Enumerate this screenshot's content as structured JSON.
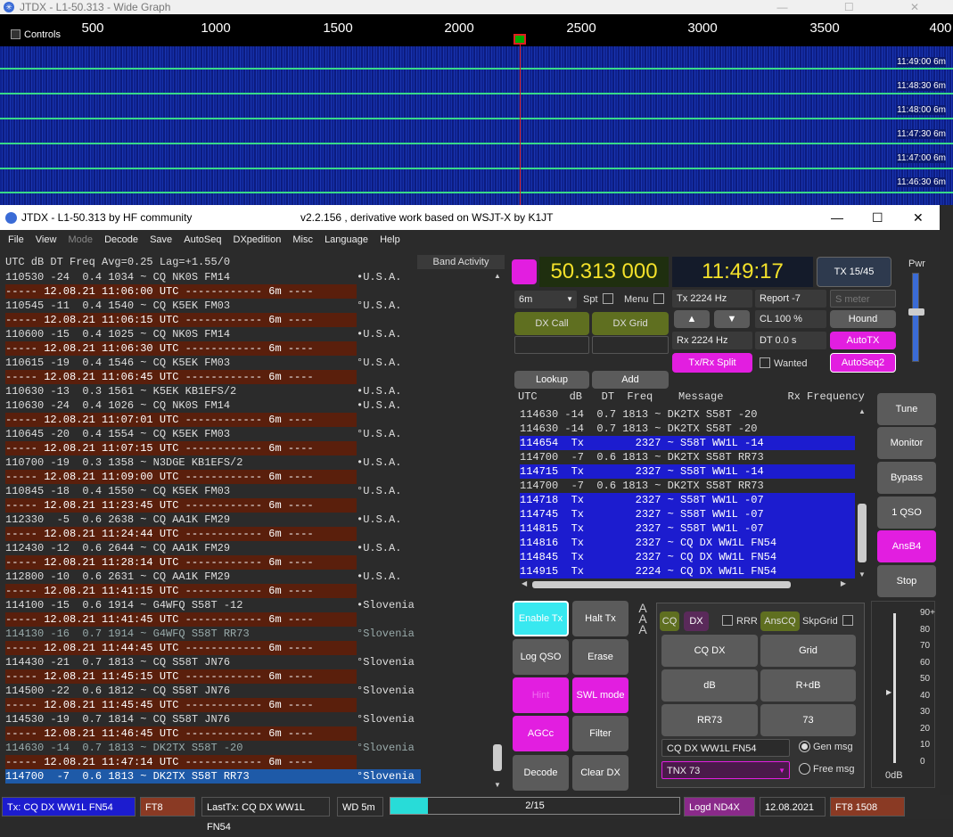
{
  "wide_graph": {
    "title": "JTDX - L1-50.313 - Wide Graph",
    "controls_label": "Controls",
    "ticks": [
      "500",
      "1000",
      "1500",
      "2000",
      "2500",
      "3000",
      "3500",
      "400"
    ],
    "times": [
      "11:49:00   6m",
      "11:48:30   6m",
      "11:48:00   6m",
      "11:47:30   6m",
      "11:47:00   6m",
      "11:46:30   6m"
    ]
  },
  "main": {
    "title": "JTDX - L1-50.313  by HF community",
    "version": "v2.2.156 , derivative work based on WSJT-X by K1JT",
    "win_min": "—",
    "win_max": "☐",
    "win_close": "✕"
  },
  "menu": [
    "File",
    "View",
    "Mode",
    "Decode",
    "Save",
    "AutoSeq",
    "DXpedition",
    "Misc",
    "Language",
    "Help"
  ],
  "band_activity": {
    "header": "UTC      dB  DT Freq    Avg=0.25 Lag=+1.55/0",
    "button": "Band Activity",
    "rows": [
      {
        "t": "110530 -24  0.4 1034 ~ CQ NK0S FM14",
        "c": "•U.S.A.",
        "k": "n"
      },
      {
        "t": "----- 12.08.21 11:06:00 UTC ------------ 6m ----",
        "c": "",
        "k": "sep"
      },
      {
        "t": "110545 -11  0.4 1540 ~ CQ K5EK FM03",
        "c": "°U.S.A.",
        "k": "n"
      },
      {
        "t": "----- 12.08.21 11:06:15 UTC ------------ 6m ----",
        "c": "",
        "k": "sep"
      },
      {
        "t": "110600 -15  0.4 1025 ~ CQ NK0S FM14",
        "c": "•U.S.A.",
        "k": "n"
      },
      {
        "t": "----- 12.08.21 11:06:30 UTC ------------ 6m ----",
        "c": "",
        "k": "sep"
      },
      {
        "t": "110615 -19  0.4 1546 ~ CQ K5EK FM03",
        "c": "°U.S.A.",
        "k": "n"
      },
      {
        "t": "----- 12.08.21 11:06:45 UTC ------------ 6m ----",
        "c": "",
        "k": "sep"
      },
      {
        "t": "110630 -13  0.3 1561 ~ K5EK KB1EFS/2",
        "c": "•U.S.A.",
        "k": "n"
      },
      {
        "t": "110630 -24  0.4 1026 ~ CQ NK0S FM14",
        "c": "•U.S.A.",
        "k": "n"
      },
      {
        "t": "----- 12.08.21 11:07:01 UTC ------------ 6m ----",
        "c": "",
        "k": "sep"
      },
      {
        "t": "110645 -20  0.4 1554 ~ CQ K5EK FM03",
        "c": "°U.S.A.",
        "k": "n"
      },
      {
        "t": "----- 12.08.21 11:07:15 UTC ------------ 6m ----",
        "c": "",
        "k": "sep"
      },
      {
        "t": "110700 -19  0.3 1358 ~ N3DGE KB1EFS/2",
        "c": "•U.S.A.",
        "k": "n"
      },
      {
        "t": "----- 12.08.21 11:09:00 UTC ------------ 6m ----",
        "c": "",
        "k": "sep"
      },
      {
        "t": "110845 -18  0.4 1550 ~ CQ K5EK FM03",
        "c": "°U.S.A.",
        "k": "n"
      },
      {
        "t": "----- 12.08.21 11:23:45 UTC ------------ 6m ----",
        "c": "",
        "k": "sep"
      },
      {
        "t": "112330  -5  0.6 2638 ~ CQ AA1K FM29",
        "c": "•U.S.A.",
        "k": "n"
      },
      {
        "t": "----- 12.08.21 11:24:44 UTC ------------ 6m ----",
        "c": "",
        "k": "sep"
      },
      {
        "t": "112430 -12  0.6 2644 ~ CQ AA1K FM29",
        "c": "•U.S.A.",
        "k": "n"
      },
      {
        "t": "----- 12.08.21 11:28:14 UTC ------------ 6m ----",
        "c": "",
        "k": "sep"
      },
      {
        "t": "112800 -10  0.6 2631 ~ CQ AA1K FM29",
        "c": "•U.S.A.",
        "k": "n"
      },
      {
        "t": "----- 12.08.21 11:41:15 UTC ------------ 6m ----",
        "c": "",
        "k": "sep"
      },
      {
        "t": "114100 -15  0.6 1914 ~ G4WFQ S58T -12",
        "c": "•Slovenia",
        "k": "n"
      },
      {
        "t": "----- 12.08.21 11:41:45 UTC ------------ 6m ----",
        "c": "",
        "k": "sep"
      },
      {
        "t": "114130 -16  0.7 1914 ~ G4WFQ S58T RR73",
        "c": "°Slovenia",
        "k": "gray"
      },
      {
        "t": "----- 12.08.21 11:44:45 UTC ------------ 6m ----",
        "c": "",
        "k": "sep"
      },
      {
        "t": "114430 -21  0.7 1813 ~ CQ S58T JN76",
        "c": "°Slovenia",
        "k": "n"
      },
      {
        "t": "----- 12.08.21 11:45:15 UTC ------------ 6m ----",
        "c": "",
        "k": "sep"
      },
      {
        "t": "114500 -22  0.6 1812 ~ CQ S58T JN76",
        "c": "°Slovenia",
        "k": "n"
      },
      {
        "t": "----- 12.08.21 11:45:45 UTC ------------ 6m ----",
        "c": "",
        "k": "sep"
      },
      {
        "t": "114530 -19  0.7 1814 ~ CQ S58T JN76",
        "c": "°Slovenia",
        "k": "n"
      },
      {
        "t": "----- 12.08.21 11:46:45 UTC ------------ 6m ----",
        "c": "",
        "k": "sep"
      },
      {
        "t": "114630 -14  0.7 1813 ~ DK2TX S58T -20",
        "c": "°Slovenia",
        "k": "gray"
      },
      {
        "t": "----- 12.08.21 11:47:14 UTC ------------ 6m ----",
        "c": "",
        "k": "sep"
      },
      {
        "t": "114700  -7  0.6 1813 ~ DK2TX S58T RR73",
        "c": "°Slovenia",
        "k": "sel"
      }
    ]
  },
  "controls": {
    "freq": "50.313 000",
    "clock": "11:49:17",
    "tx_period": "TX 15/45",
    "pwr": "Pwr",
    "band": "6m",
    "spt": "Spt",
    "menu": "Menu",
    "tx_hz": "Tx  2224  Hz",
    "rx_hz": "Rx  2224  Hz",
    "report": "Report -7",
    "smeter": "S meter",
    "cl": "CL  100 %",
    "dt": "DT 0.0 s",
    "hound": "Hound",
    "autotx": "AutoTX",
    "autoseq2": "AutoSeq2",
    "wanted": "Wanted",
    "dxcall": "DX Call",
    "dxgrid": "DX Grid",
    "up": "▲",
    "down": "▼",
    "split": "Tx/Rx Split",
    "lookup": "Lookup",
    "add": "Add"
  },
  "rx_panel": {
    "header": "UTC     dB   DT  Freq    Message          Rx Frequency",
    "rows": [
      {
        "t": "114630 -14  0.7 1813 ~ DK2TX S58T -20",
        "k": "n"
      },
      {
        "t": "114630 -14  0.7 1813 ~ DK2TX S58T -20",
        "k": "n"
      },
      {
        "t": "114654  Tx        2327 ~ S58T WW1L -14",
        "k": "tx"
      },
      {
        "t": "114700  -7  0.6 1813 ~ DK2TX S58T RR73",
        "k": "n"
      },
      {
        "t": "114715  Tx        2327 ~ S58T WW1L -14",
        "k": "tx"
      },
      {
        "t": "114700  -7  0.6 1813 ~ DK2TX S58T RR73",
        "k": "n"
      },
      {
        "t": "114718  Tx        2327 ~ S58T WW1L -07",
        "k": "tx"
      },
      {
        "t": "114745  Tx        2327 ~ S58T WW1L -07",
        "k": "tx"
      },
      {
        "t": "114815  Tx        2327 ~ S58T WW1L -07",
        "k": "tx"
      },
      {
        "t": "114816  Tx        2327 ~ CQ DX WW1L FN54",
        "k": "tx"
      },
      {
        "t": "114845  Tx        2327 ~ CQ DX WW1L FN54",
        "k": "tx"
      },
      {
        "t": "114915  Tx        2224 ~ CQ DX WW1L FN54",
        "k": "tx"
      }
    ]
  },
  "side_buttons": [
    "Tune",
    "Monitor",
    "Bypass",
    "1 QSO",
    "AnsB4",
    "Stop"
  ],
  "action_buttons": {
    "enable_tx": "Enable Tx",
    "halt_tx": "Halt Tx",
    "log_qso": "Log QSO",
    "erase": "Erase",
    "hint": "Hint",
    "swl": "SWL mode",
    "agcc": "AGCc",
    "filter": "Filter",
    "decode": "Decode",
    "clear_dx": "Clear DX"
  },
  "tx_panel": {
    "cq": "CQ",
    "dx": "DX",
    "rrr": "RRR",
    "anscq": "AnsCQ",
    "skpgrid": "SkpGrid",
    "buttons": [
      "CQ DX",
      "Grid",
      "dB",
      "R+dB",
      "RR73",
      "73"
    ],
    "gen_msg_text": "CQ DX WW1L FN54",
    "free_msg_text": "TNX 73",
    "gen_msg": "Gen msg",
    "free_msg": "Free msg"
  },
  "meter": {
    "ticks": [
      "90+",
      "80",
      "70",
      "60",
      "50",
      "40",
      "30",
      "20",
      "10",
      "0"
    ],
    "label": "0dB"
  },
  "status": {
    "tx": "Tx: CQ DX WW1L FN54",
    "mode": "FT8",
    "lasttx": "LastTx: CQ DX WW1L FN54",
    "wd": "WD 5m",
    "progress_text": "2/15",
    "progress": 0.13,
    "logd": "Logd ND4X",
    "date": "12.08.2021",
    "ft8": "FT8   1508"
  }
}
